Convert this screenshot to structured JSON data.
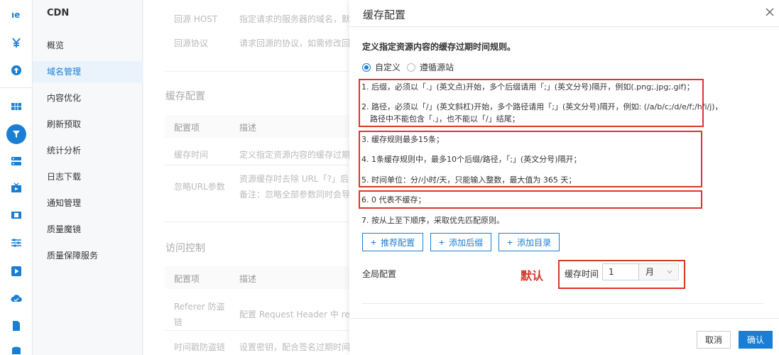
{
  "nav": {
    "title": "CDN",
    "items": [
      {
        "label": "概览"
      },
      {
        "label": "域名管理",
        "active": true
      },
      {
        "label": "内容优化"
      },
      {
        "label": "刷新预取"
      },
      {
        "label": "统计分析"
      },
      {
        "label": "日志下载"
      },
      {
        "label": "通知管理"
      },
      {
        "label": "质量魔镜"
      },
      {
        "label": "质量保障服务"
      }
    ]
  },
  "background": {
    "rows_top": [
      {
        "label": "回源 HOST",
        "desc": "指定请求的服务器的域名，默认为"
      },
      {
        "label": "回源协议",
        "desc": "请求回源的协议，如需修改回源协"
      }
    ],
    "cache_section": {
      "title": "缓存配置",
      "col_item": "配置项",
      "col_desc": "描述",
      "rows": [
        {
          "label": "缓存时间",
          "desc": "定义指定资源内容的缓存过期时间"
        },
        {
          "label": "忽略URL参数",
          "desc": "资源缓存时去除 URL「?」后的全",
          "desc2": "备注：忽略全部参数同时会导致"
        }
      ]
    },
    "access_section": {
      "title": "访问控制",
      "col_item": "配置项",
      "col_desc": "描述",
      "rows": [
        {
          "label": "Referer 防盗",
          "label2": "链",
          "desc": "配置 Request Header 中 referer"
        },
        {
          "label": "时间戳防盗链",
          "desc": "设置密钥，配合签名过期时间来控"
        }
      ]
    }
  },
  "modal": {
    "title": "缓存配置",
    "description": "定义指定资源内容的缓存过期时间规则。",
    "radio_custom": "自定义",
    "radio_origin": "遵循源站",
    "rules": {
      "r1": "1. 后缀，必须以「.」(英文点)开始，多个后缀请用「;」(英文分号)隔开，例如(.png;.jpg;.gif)；",
      "r2a": "2. 路径，必须以「/」(英文斜杠)开始，多个路径请用「;」(英文分号)隔开，例如: (/a/b/c;/d/e/f;/h/i/j)，",
      "r2b": "路径中不能包含「.」，也不能以「/」结尾；",
      "r3": "3. 缓存规则最多15条；",
      "r4": "4. 1条缓存规则中，最多10个后缀/路径，「;」(英文分号)隔开；",
      "r5": "5. 时间单位：分/小时/天，只能输入整数，最大值为 365 天；",
      "r6": "6. 0 代表不缓存；",
      "r7": "7. 按从上至下顺序，采取优先匹配原则。"
    },
    "btn_recommend": "推荐配置",
    "btn_add_suffix": "添加后缀",
    "btn_add_dir": "添加目录",
    "global_label": "全局配置",
    "default_label": "默认",
    "cache_time_label": "缓存时间",
    "cache_time_value": "1",
    "cache_unit": "月",
    "cancel": "取消",
    "confirm": "确认"
  },
  "colors": {
    "accent": "#1a7fd4",
    "annotation_red": "#d9362c"
  },
  "icons": {
    "rail": [
      "logo-icon",
      "yuan-icon",
      "upload-icon",
      "grid-icon",
      "funnel-icon",
      "server-icon",
      "tv-icon",
      "film-icon",
      "sliders-icon",
      "play-icon",
      "cloud-icon",
      "doc-icon",
      "database-icon"
    ]
  }
}
